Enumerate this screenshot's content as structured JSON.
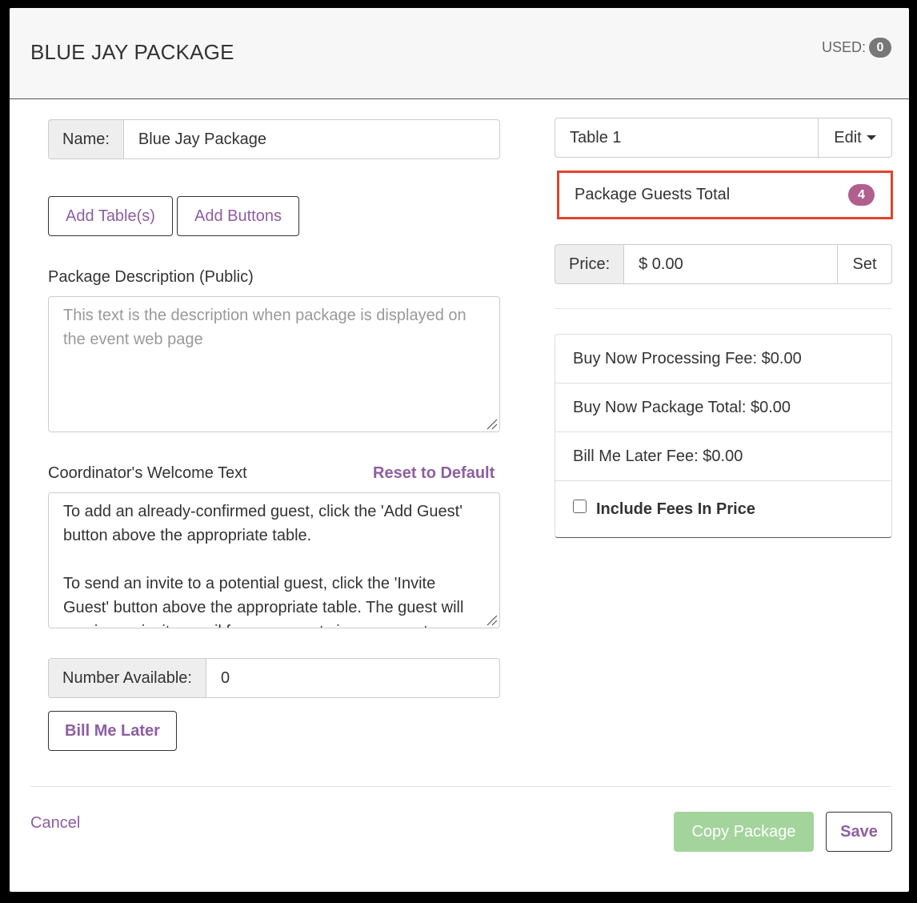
{
  "header": {
    "title": "BLUE JAY PACKAGE",
    "used_label": "USED:",
    "used_count": "0"
  },
  "form": {
    "name_label": "Name:",
    "name_value": "Blue Jay Package",
    "add_tables_label": "Add Table(s)",
    "add_buttons_label": "Add Buttons",
    "description_label": "Package Description (Public)",
    "description_placeholder": "This text is the description when package is displayed on the event web page",
    "welcome_label": "Coordinator's Welcome Text",
    "reset_label": "Reset to Default",
    "welcome_text": "To add an already-confirmed guest, click the 'Add Guest' button above the appropriate table.\n\nTo send an invite to a potential guest, click the 'Invite Guest' button above the appropriate table. The guest will receive an invite email for your event via your event-specific",
    "number_available_label": "Number Available:",
    "number_available_value": "0",
    "bill_me_later_label": "Bill Me Later"
  },
  "side": {
    "table_value": "Table 1",
    "edit_label": "Edit",
    "guests_total_label": "Package Guests Total",
    "guests_total_count": "4",
    "price_label": "Price:",
    "price_value": "$ 0.00",
    "set_label": "Set",
    "fees": [
      "Buy Now Processing Fee: $0.00",
      "Buy Now Package Total: $0.00",
      "Bill Me Later Fee: $0.00"
    ],
    "include_fees_label": "Include Fees In Price"
  },
  "footer": {
    "cancel_label": "Cancel",
    "copy_label": "Copy Package",
    "save_label": "Save"
  },
  "colors": {
    "accent_purple": "#8e5ea2",
    "highlight_red": "#e0462b",
    "badge_pink": "#b15f8f",
    "copy_green": "#a3d49c"
  }
}
